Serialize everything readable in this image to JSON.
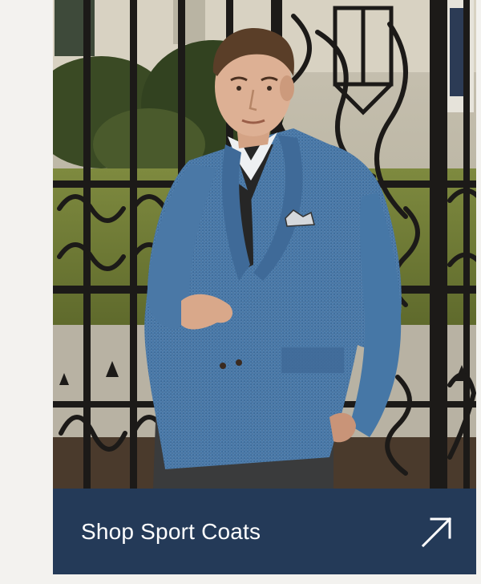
{
  "promo": {
    "cta_label": "Shop Sport Coats",
    "arrow_icon": "arrow-up-right-icon",
    "image_subject": "man-in-blue-sport-coat-photo"
  },
  "colors": {
    "page_background": "#f3f2ef",
    "cta_background": "#243a58",
    "cta_text": "#ffffff",
    "coat_blue": "#4f7fae",
    "gate_iron": "#1c1a18"
  }
}
